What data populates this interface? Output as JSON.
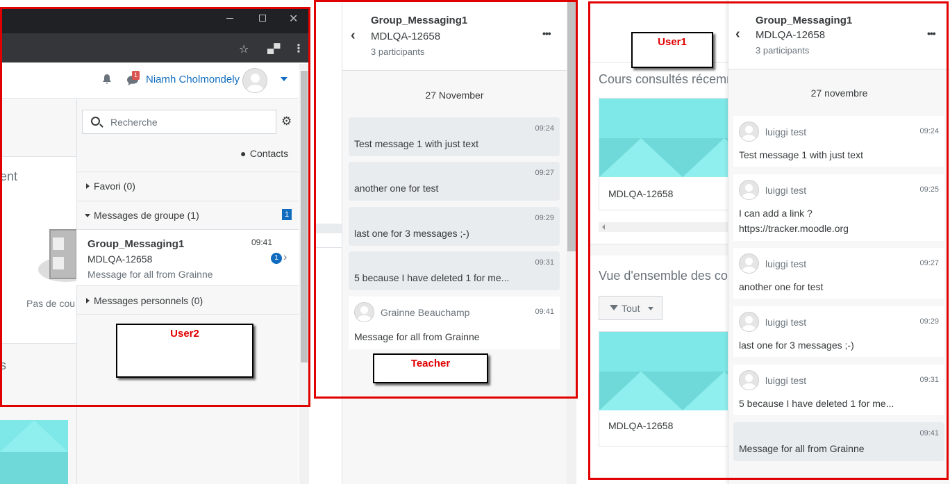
{
  "user2": {
    "label": "User2",
    "user_name": "Niamh Cholmondely",
    "notif_count": "1",
    "partial_text_1": "ent",
    "partial_text_2": "Pas de cou",
    "partial_text_3": "s",
    "search_placeholder": "Recherche",
    "contacts_label": "Contacts",
    "favourites": "Favori (0)",
    "group_messages": "Messages de groupe (1)",
    "group_count": "1",
    "conversation": {
      "title": "Group_Messaging1",
      "subtitle": "MDLQA-12658",
      "time": "09:41",
      "preview": "Message for all from Grainne",
      "unread": "1"
    },
    "personal_messages": "Messages personnels (0)"
  },
  "teacher": {
    "label": "Teacher",
    "header": {
      "title": "Group_Messaging1",
      "subtitle": "MDLQA-12658",
      "participants": "3 participants"
    },
    "date": "27 November",
    "messages": [
      {
        "time": "09:24",
        "text": "Test message 1 with just text"
      },
      {
        "time": "09:27",
        "text": "another one for test"
      },
      {
        "time": "09:29",
        "text": "last one for 3 messages ;-)"
      },
      {
        "time": "09:31",
        "text": "5 because I have deleted 1 for me..."
      }
    ],
    "incoming": {
      "sender": "Grainne Beauchamp",
      "time": "09:41",
      "text": "Message for all from Grainne"
    }
  },
  "user1": {
    "label": "User1",
    "recent_courses": "Cours consultés récemm",
    "course_name_1": "MDLQA-12658",
    "overview": "Vue d'ensemble des cou",
    "filter_label": "Tout",
    "course_name_2": "MDLQA-12658",
    "header": {
      "title": "Group_Messaging1",
      "subtitle": "MDLQA-12658",
      "participants": "3 participants"
    },
    "date": "27 novembre",
    "messages": [
      {
        "sender": "luiggi test",
        "time": "09:24",
        "text": "Test message 1 with just text"
      },
      {
        "sender": "luiggi test",
        "time": "09:25",
        "text": "I can add a link ?",
        "text2": "https://tracker.moodle.org"
      },
      {
        "sender": "luiggi test",
        "time": "09:27",
        "text": "another one for test"
      },
      {
        "sender": "luiggi test",
        "time": "09:29",
        "text": "last one for 3 messages ;-)"
      },
      {
        "sender": "luiggi test",
        "time": "09:31",
        "text": "5 because I have deleted 1 for me..."
      }
    ],
    "own_message": {
      "time": "09:41",
      "text": "Message for all from Grainne"
    }
  },
  "colors": {
    "red": "#e00000",
    "link": "#0f6cbf",
    "bubble": "#e9ecef",
    "teal": "#7ee7e7"
  }
}
